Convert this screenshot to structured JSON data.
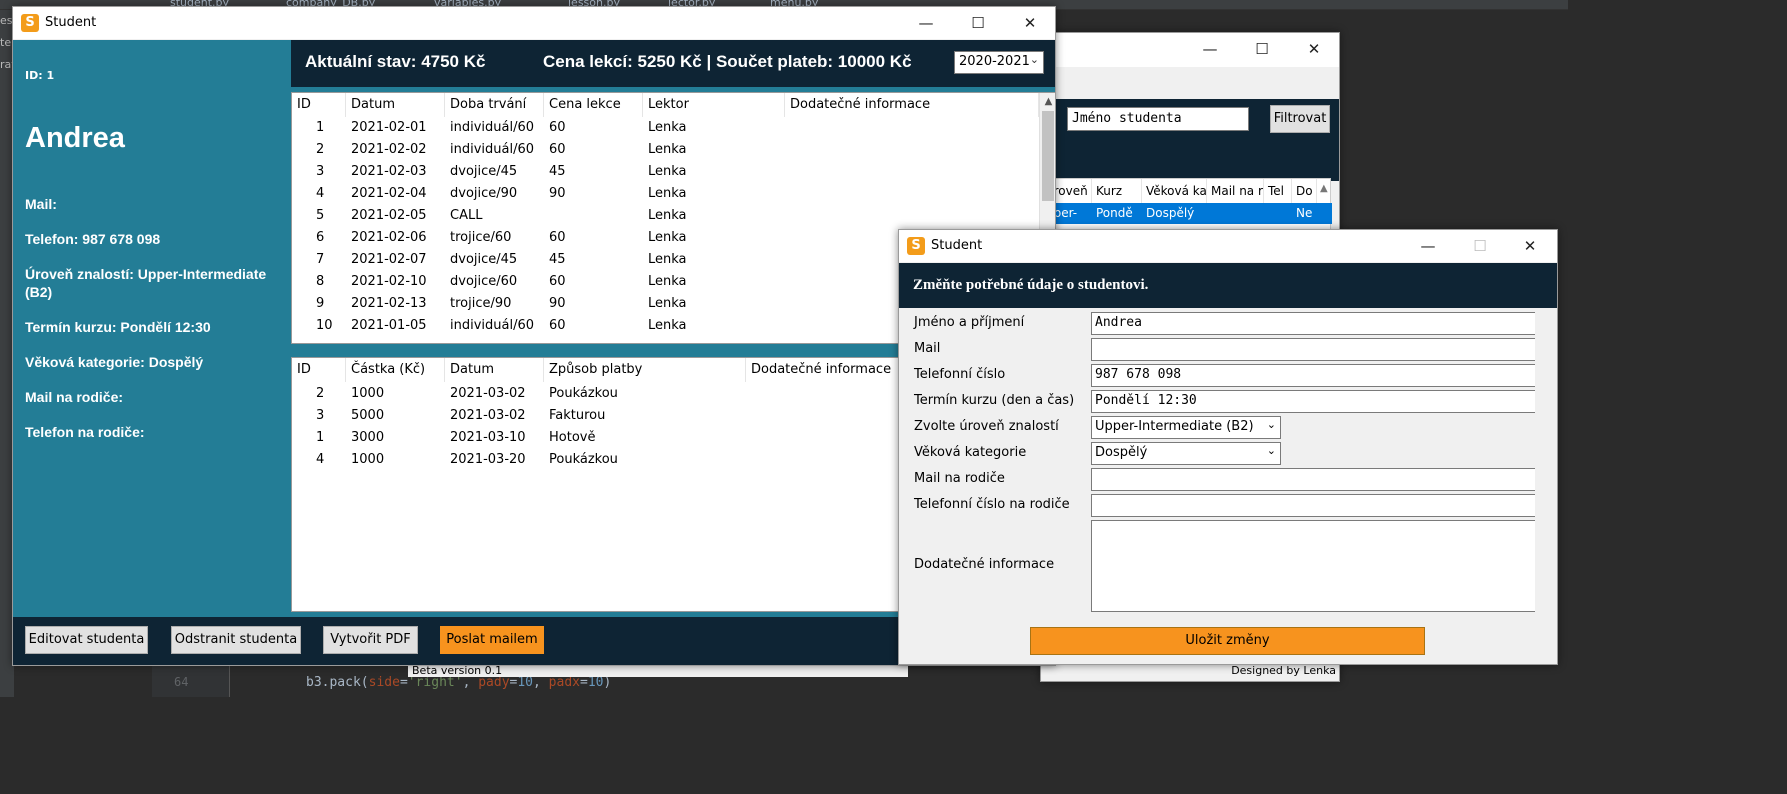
{
  "ide": {
    "tabs": [
      "student.py",
      "company_DB.py",
      "variables.py",
      "lesson.py",
      "lector.py",
      "menu.py"
    ],
    "side_items": [
      "esk",
      "ter",
      "rat"
    ],
    "line_number": "64",
    "code": {
      "fn": "b3.pack(",
      "kw1": "side",
      "eq1": "=",
      "s1": "'right'",
      "c1": ", ",
      "kw2": "pady",
      "eq2": "=",
      "n1": "10",
      "c2": ", ",
      "kw3": "padx",
      "eq3": "=",
      "n2": "10",
      "end": ")"
    }
  },
  "filter_window": {
    "search_placeholder": "Jméno studenta",
    "filter_button": "Filtrovat",
    "headers": [
      "úroveň",
      "Kurz",
      "Věková ka",
      "Mail na r",
      "Tel",
      "Do"
    ],
    "row": [
      "pper-",
      "Pondě",
      "Dospělý",
      "",
      "",
      "Ne"
    ],
    "beta": "Beta version 0.1",
    "designed": "Designed by Lenka"
  },
  "main_window": {
    "title": "Student",
    "id_label": "ID: 1",
    "name": "Andrea",
    "fields": [
      "Mail:",
      "Telefon: 987 678 098",
      "Úroveň znalostí: Upper-Intermediate (B2)",
      "Termín kurzu: Pondělí 12:30",
      "Věková kategorie: Dospělý",
      "Mail na rodiče:",
      "Telefon na rodiče:"
    ],
    "status": {
      "current": "Aktuální stav:  4750 Kč",
      "summary": "Cena lekcí: 5250 Kč | Součet plateb: 10000 Kč"
    },
    "year": "2020-2021",
    "lessons": {
      "headers": [
        "ID",
        "Datum",
        "Doba trvání",
        "Cena lekce",
        "Lektor",
        "Dodatečné informace"
      ],
      "rows": [
        [
          "1",
          "2021-02-01",
          "individuál/60",
          "60",
          "Lenka",
          ""
        ],
        [
          "2",
          "2021-02-02",
          "individuál/60",
          "60",
          "Lenka",
          ""
        ],
        [
          "3",
          "2021-02-03",
          "dvojice/45",
          "45",
          "Lenka",
          ""
        ],
        [
          "4",
          "2021-02-04",
          "dvojice/90",
          "90",
          "Lenka",
          ""
        ],
        [
          "5",
          "2021-02-05",
          "CALL",
          "",
          "Lenka",
          ""
        ],
        [
          "6",
          "2021-02-06",
          "trojice/60",
          "60",
          "Lenka",
          ""
        ],
        [
          "7",
          "2021-02-07",
          "dvojice/45",
          "45",
          "Lenka",
          ""
        ],
        [
          "8",
          "2021-02-10",
          "dvojice/60",
          "60",
          "Lenka",
          ""
        ],
        [
          "9",
          "2021-02-13",
          "trojice/90",
          "90",
          "Lenka",
          ""
        ],
        [
          "10",
          "2021-01-05",
          "individuál/60",
          "60",
          "Lenka",
          ""
        ]
      ]
    },
    "payments": {
      "headers": [
        "ID",
        "Částka (Kč)",
        "Datum",
        "Způsob platby",
        "Dodatečné informace"
      ],
      "rows": [
        [
          "2",
          "1000",
          "2021-03-02",
          "Poukázkou",
          ""
        ],
        [
          "3",
          "5000",
          "2021-03-02",
          "Fakturou",
          ""
        ],
        [
          "1",
          "3000",
          "2021-03-10",
          "Hotově",
          ""
        ],
        [
          "4",
          "1000",
          "2021-03-20",
          "Poukázkou",
          ""
        ]
      ]
    },
    "buttons": {
      "edit": "Editovat studenta",
      "delete": "Odstranit studenta",
      "pdf": "Vytvořit PDF",
      "mail": "Poslat mailem"
    }
  },
  "edit_window": {
    "title": "Student",
    "heading": "Změňte potřebné údaje o studentovi.",
    "labels": {
      "name": "Jméno a příjmení",
      "mail": "Mail",
      "phone": "Telefonní číslo",
      "term": "Termín kurzu (den a čas)",
      "level": "Zvolte úroveň znalostí",
      "age": "Věková kategorie",
      "parent_mail": "Mail na rodiče",
      "parent_phone": "Telefonní číslo na rodiče",
      "info": "Dodatečné informace"
    },
    "values": {
      "name": "Andrea",
      "mail": "",
      "phone": "987 678 098",
      "term": "Pondělí 12:30",
      "level": "Upper-Intermediate (B2)",
      "age": "Dospělý",
      "parent_mail": "",
      "parent_phone": ""
    },
    "save": "Uložit změny"
  },
  "colors": {
    "panel_teal": "#237d96",
    "dark_navy": "#0e2434",
    "accent_orange": "#f7931e",
    "selection_blue": "#0078d7"
  }
}
